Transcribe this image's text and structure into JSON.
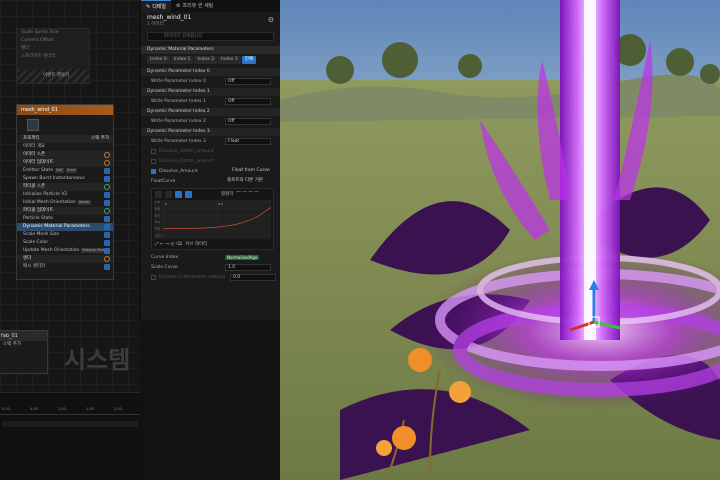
{
  "graph": {
    "top_node_rows": [
      "Scale Sprite Size",
      "Camera Offset",
      "렌더",
      "스프라이트 렌더러"
    ],
    "top_node_footer": "이벤트 핸들러",
    "emitter": {
      "title": "mesh_wind_01",
      "rows": [
        {
          "label": "프로퍼티",
          "kind": "sec",
          "right": "스택 추가"
        },
        {
          "label": "이미터 개요",
          "kind": "row"
        },
        {
          "label": "이미터 스폰",
          "kind": "sec",
          "icon": "plus"
        },
        {
          "label": "이미터 업데이트",
          "kind": "sec",
          "icon": "plus"
        },
        {
          "label": "Emitter State",
          "kind": "row",
          "tag1": "Self",
          "tag2": "Once",
          "icon": "check"
        },
        {
          "label": "Spawn Burst Instantaneous",
          "kind": "row",
          "icon": "check"
        },
        {
          "label": "파티클 스폰",
          "kind": "sec",
          "icon": "plus-g"
        },
        {
          "label": "Initialize Particle V2",
          "kind": "row",
          "icon": "check"
        },
        {
          "label": "Initial Mesh Orientation",
          "kind": "row",
          "tag1": "Vector",
          "icon": "check"
        },
        {
          "label": "파티클 업데이트",
          "kind": "sec",
          "icon": "plus-g"
        },
        {
          "label": "Particle State",
          "kind": "row",
          "icon": "check"
        },
        {
          "label": "Dynamic Material Parameters",
          "kind": "sel",
          "icon": "check"
        },
        {
          "label": "Scale Mesh Size",
          "kind": "row",
          "icon": "check"
        },
        {
          "label": "Scale Color",
          "kind": "row",
          "icon": "check"
        },
        {
          "label": "Update Mesh Orientation",
          "kind": "row",
          "tag1": "Rotation Rate",
          "icon": "check"
        },
        {
          "label": "렌더",
          "kind": "sec",
          "icon": "plus"
        },
        {
          "label": "메시 렌더러",
          "kind": "row",
          "icon": "check"
        }
      ]
    },
    "emitter2": {
      "title": "fab_01",
      "row": "스택 추가"
    },
    "system_label": "시스템",
    "timeline_ticks": [
      "0.00",
      "0.50",
      "1.00",
      "1.50",
      "2.00"
    ]
  },
  "details": {
    "tabs": [
      "디테일",
      "프리뷰 씬 세팅"
    ],
    "emitter_name": "mesh_wind_01",
    "emitter_sub": "1 이미터",
    "search_placeholder": "파라미터 검색합니다",
    "section_title": "Dynamic Material Parameters",
    "index_tabs": [
      "Index 0",
      "Index 1",
      "Index 2",
      "Index 3",
      "전체"
    ],
    "groups": [
      {
        "title": "Dynamic Parameter Index 0",
        "label": "Write Parameter Index 0",
        "value": "Off"
      },
      {
        "title": "Dynamic Parameter Index 1",
        "label": "Write Parameter Index 1",
        "value": "Off"
      },
      {
        "title": "Dynamic Parameter Index 2",
        "label": "Write Parameter Index 2",
        "value": "Off"
      },
      {
        "title": "Dynamic Parameter Index 3",
        "label": "Write Parameter Index 3",
        "value": "Float"
      }
    ],
    "disabled_rows": [
      "Dissolve_Dstrtn_amount",
      "Dissolve_Dstrtn_amount"
    ],
    "dissolve_label": "Dissolve_Amount",
    "dissolve_value": "Float from Curve",
    "float_curve_label": "FloatCurve",
    "float_curve_value": "플로트의 다른 기본",
    "curve_right_label": "평평하",
    "curve_foot_label": "커브 데이터",
    "curve_y_ticks": [
      "1.0",
      "0.8",
      "0.5",
      "0.3",
      "0.0",
      "-0.3"
    ],
    "curve_x_ticks": [
      "0",
      "0.5",
      "1"
    ],
    "curve_index_label": "Curve Index",
    "curve_index_tag": "NormalizedAge",
    "scale_curve_label": "Scale Curve",
    "scale_curve_value": "1.0",
    "random_label": "Random 0 Parameter without",
    "random_value": "0.0"
  },
  "colors": {
    "accent": "#2b73c8",
    "emitter_header": "#a85b1c",
    "curve": "#c94a3a",
    "beam": "#c02ff0"
  }
}
